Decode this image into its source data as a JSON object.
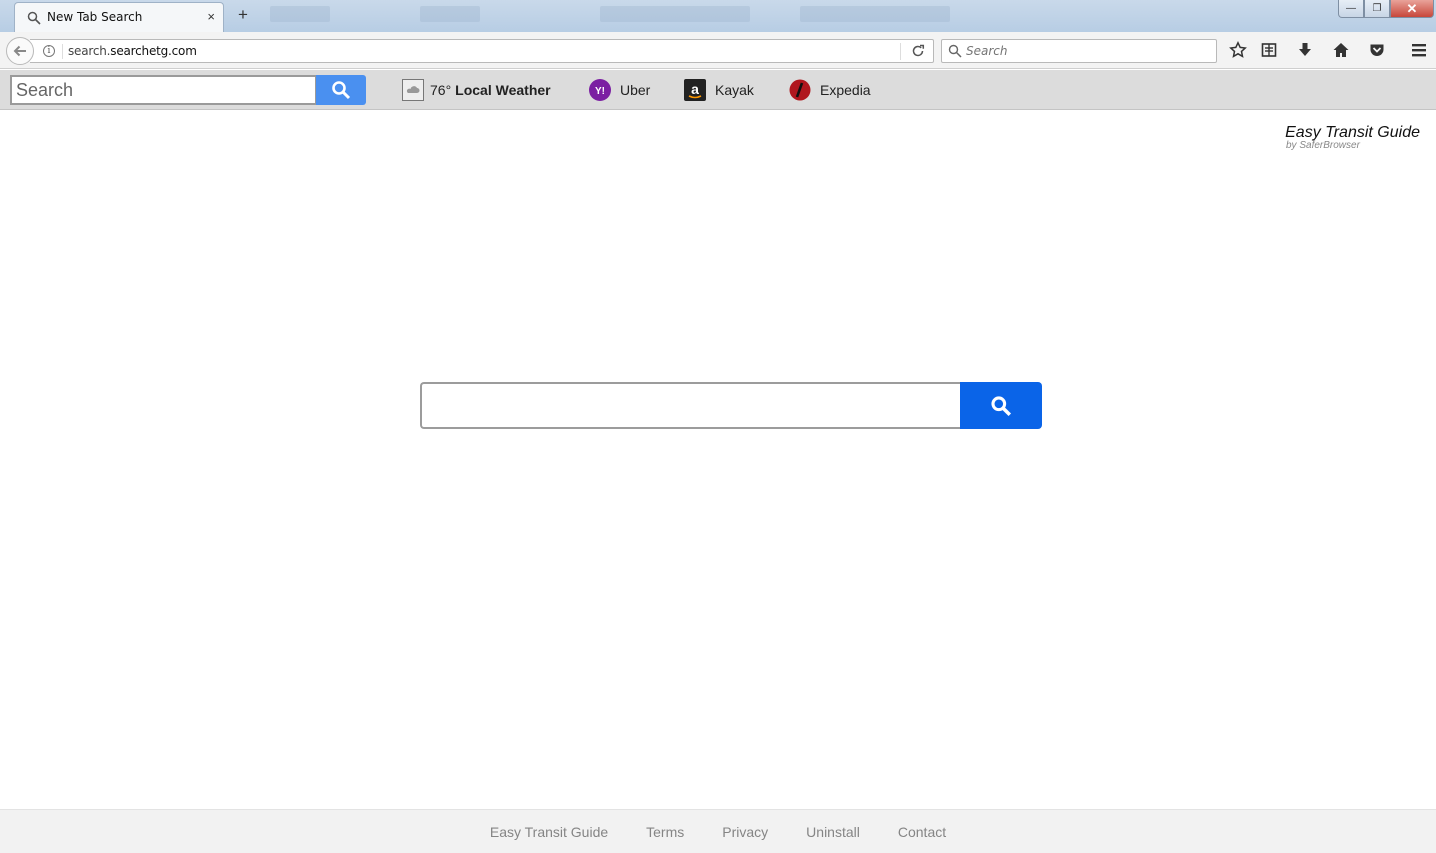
{
  "browser": {
    "tab": {
      "title": "New Tab Search",
      "close": "×"
    },
    "new_tab": "+",
    "window_controls": {
      "minimize": "—",
      "restore": "❐",
      "close": "✕"
    },
    "url": {
      "host_prefix": "search.",
      "host_domain": "searchetg.com"
    },
    "search_placeholder": "Search",
    "toolbar_icons": [
      "star-icon",
      "reading-list-icon",
      "download-icon",
      "home-icon",
      "pocket-icon",
      "menu-icon"
    ]
  },
  "extension_toolbar": {
    "search_placeholder": "Search",
    "weather": {
      "temp": "76°",
      "label": "Local Weather"
    },
    "links": [
      {
        "label": "Uber",
        "icon": "yahoo-icon",
        "color": "#7b1fa2"
      },
      {
        "label": "Kayak",
        "icon": "amazon-icon",
        "color": "#222222"
      },
      {
        "label": "Expedia",
        "icon": "expedia-icon",
        "color": "#b0171e"
      }
    ],
    "accent_color": "#4a90f0"
  },
  "brand": {
    "title": "Easy Transit Guide",
    "subtitle": "by SaferBrowser"
  },
  "main_search": {
    "value": "",
    "button_color": "#0a64e8"
  },
  "footer": {
    "links": [
      "Easy Transit Guide",
      "Terms",
      "Privacy",
      "Uninstall",
      "Contact"
    ]
  }
}
